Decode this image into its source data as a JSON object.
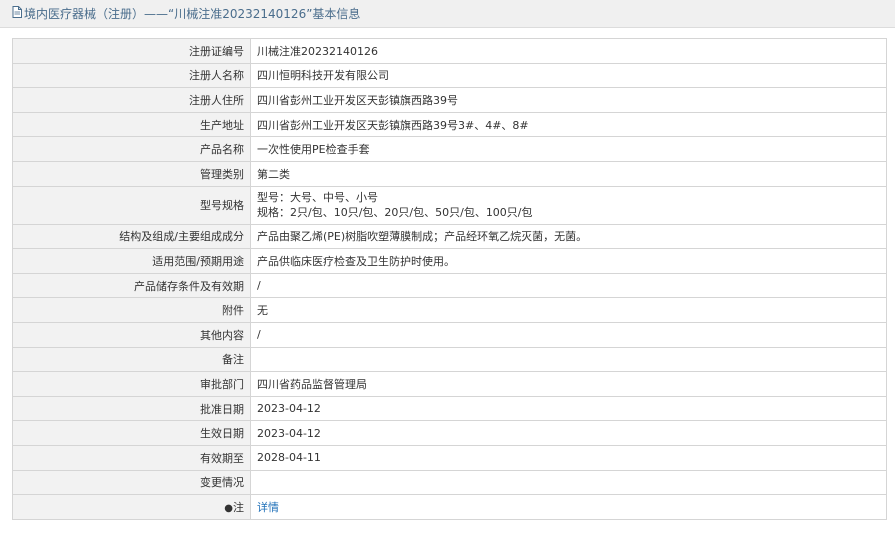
{
  "header": {
    "title": "境内医疗器械（注册）——“川械注准20232140126”基本信息"
  },
  "rows": [
    {
      "label": "注册证编号",
      "value": "川械注准20232140126"
    },
    {
      "label": "注册人名称",
      "value": "四川恒明科技开发有限公司"
    },
    {
      "label": "注册人住所",
      "value": "四川省彭州工业开发区天彭镇旗西路39号"
    },
    {
      "label": "生产地址",
      "value": "四川省彭州工业开发区天彭镇旗西路39号3#、4#、8#"
    },
    {
      "label": "产品名称",
      "value": "一次性使用PE检查手套"
    },
    {
      "label": "管理类别",
      "value": "第二类"
    },
    {
      "label": "型号规格",
      "value_line1": "型号：大号、中号、小号",
      "value_line2": "规格：2只/包、10只/包、20只/包、50只/包、100只/包"
    },
    {
      "label": "结构及组成/主要组成成分",
      "value": "产品由聚乙烯(PE)树脂吹塑薄膜制成；产品经环氧乙烷灭菌，无菌。"
    },
    {
      "label": "适用范围/预期用途",
      "value": "产品供临床医疗检查及卫生防护时使用。"
    },
    {
      "label": "产品储存条件及有效期",
      "value": "/"
    },
    {
      "label": "附件",
      "value": "无"
    },
    {
      "label": "其他内容",
      "value": "/"
    },
    {
      "label": "备注",
      "value": ""
    },
    {
      "label": "审批部门",
      "value": "四川省药品监督管理局"
    },
    {
      "label": "批准日期",
      "value": "2023-04-12"
    },
    {
      "label": "生效日期",
      "value": "2023-04-12"
    },
    {
      "label": "有效期至",
      "value": "2028-04-11"
    },
    {
      "label": "变更情况",
      "value": ""
    },
    {
      "label": "注",
      "value": "详情"
    }
  ]
}
